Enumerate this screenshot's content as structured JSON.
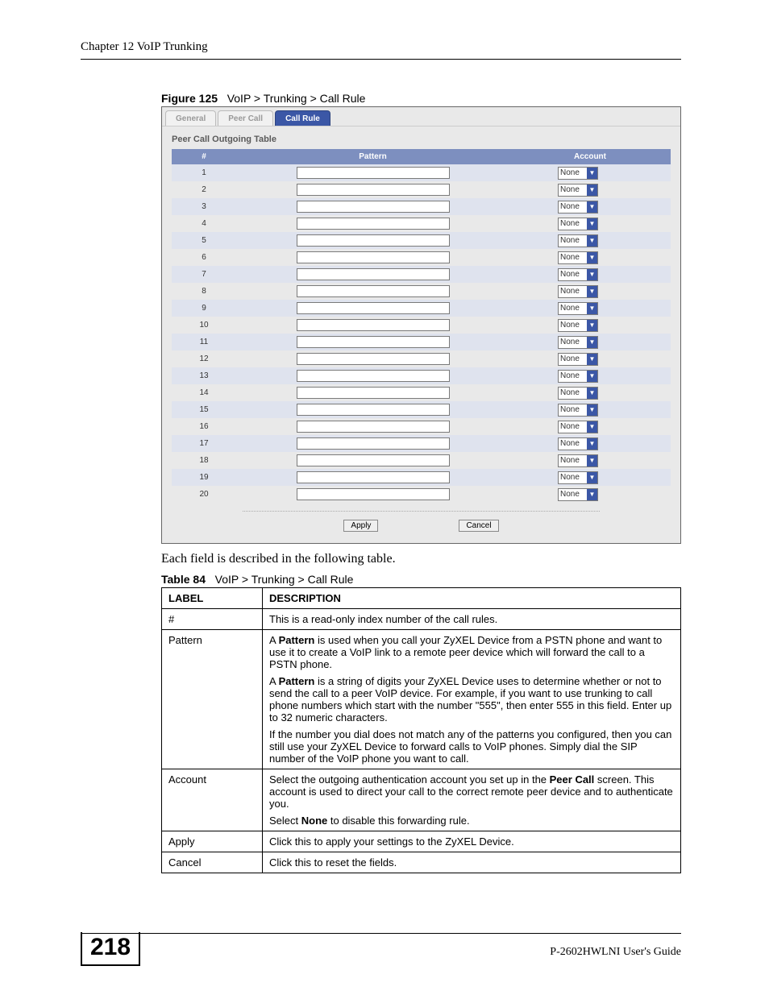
{
  "header": {
    "chapter": "Chapter 12 VoIP Trunking"
  },
  "figure": {
    "label": "Figure 125",
    "path": "VoIP > Trunking > Call Rule"
  },
  "shot": {
    "tabs": {
      "general": "General",
      "peer": "Peer Call",
      "rule": "Call Rule"
    },
    "section": "Peer Call Outgoing Table",
    "head": {
      "num": "#",
      "pattern": "Pattern",
      "account": "Account"
    },
    "rows": [
      {
        "n": "1",
        "acc": "None"
      },
      {
        "n": "2",
        "acc": "None"
      },
      {
        "n": "3",
        "acc": "None"
      },
      {
        "n": "4",
        "acc": "None"
      },
      {
        "n": "5",
        "acc": "None"
      },
      {
        "n": "6",
        "acc": "None"
      },
      {
        "n": "7",
        "acc": "None"
      },
      {
        "n": "8",
        "acc": "None"
      },
      {
        "n": "9",
        "acc": "None"
      },
      {
        "n": "10",
        "acc": "None"
      },
      {
        "n": "11",
        "acc": "None"
      },
      {
        "n": "12",
        "acc": "None"
      },
      {
        "n": "13",
        "acc": "None"
      },
      {
        "n": "14",
        "acc": "None"
      },
      {
        "n": "15",
        "acc": "None"
      },
      {
        "n": "16",
        "acc": "None"
      },
      {
        "n": "17",
        "acc": "None"
      },
      {
        "n": "18",
        "acc": "None"
      },
      {
        "n": "19",
        "acc": "None"
      },
      {
        "n": "20",
        "acc": "None"
      }
    ],
    "apply": "Apply",
    "cancel": "Cancel"
  },
  "intro": "Each field is described in the following table.",
  "tcap": {
    "label": "Table 84",
    "path": "VoIP > Trunking > Call Rule"
  },
  "table": {
    "h1": "LABEL",
    "h2": "DESCRIPTION",
    "r1": {
      "l": "#",
      "d": "This is a read-only index number of the call rules."
    },
    "r2": {
      "l": "Pattern",
      "p1a": "A ",
      "p1b": "Pattern",
      "p1c": " is used when you call your ZyXEL Device from a PSTN phone and want to use it to create a VoIP link to a remote peer device which will forward the call to a PSTN phone.",
      "p2a": "A ",
      "p2b": "Pattern",
      "p2c": " is a string of digits your ZyXEL Device uses to determine whether or not to send the call to a peer VoIP device. For example, if you want to use trunking to call phone numbers which start with the number \"555\", then enter 555 in this field. Enter up to 32 numeric characters.",
      "p3": "If the number you dial does not match any of the patterns you configured, then you can still use your ZyXEL Device to forward calls to VoIP phones. Simply dial the SIP number of the VoIP phone you want to call."
    },
    "r3": {
      "l": "Account",
      "p1a": "Select the outgoing authentication account you set up in the ",
      "p1b": "Peer Call",
      "p1c": " screen. This account is used to direct your call to the correct remote peer device and to authenticate you.",
      "p2a": "Select ",
      "p2b": "None",
      "p2c": " to disable this forwarding rule."
    },
    "r4": {
      "l": "Apply",
      "d": "Click this to apply your settings to the ZyXEL Device."
    },
    "r5": {
      "l": "Cancel",
      "d": "Click this to reset the fields."
    }
  },
  "footer": {
    "page": "218",
    "guide": "P-2602HWLNI User's Guide"
  }
}
